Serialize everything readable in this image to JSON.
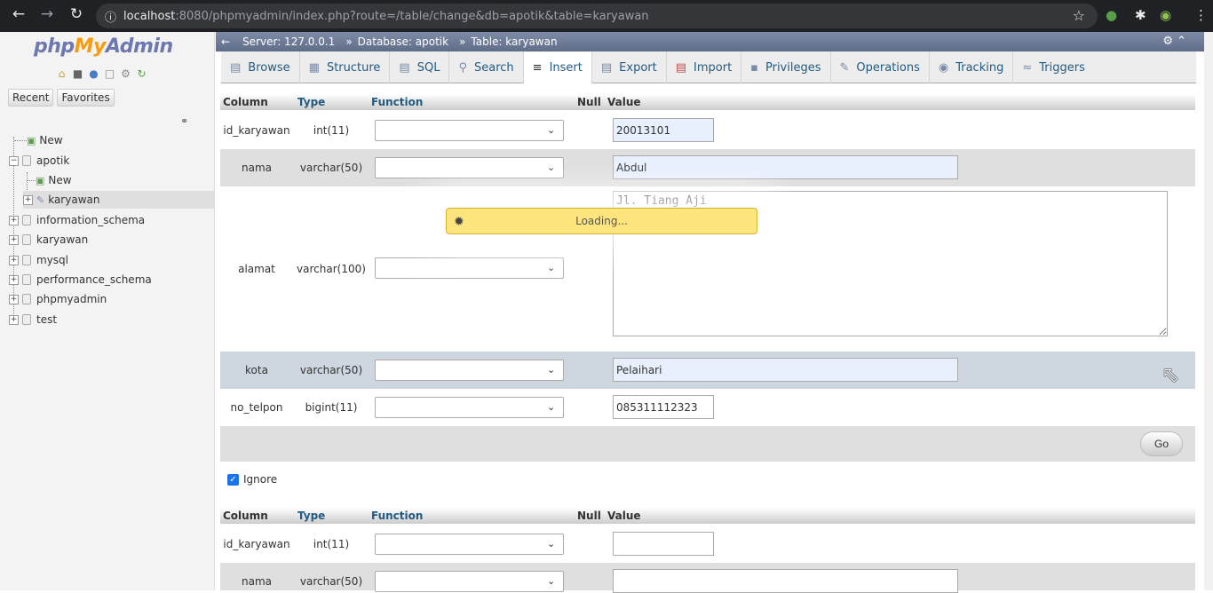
{
  "browser": {
    "url_host": "localhost",
    "url_rest": ":8080/phpmyadmin/index.php?route=/table/change&db=apotik&table=karyawan"
  },
  "nav": {
    "logo": {
      "php": "php",
      "my": "My",
      "admin": "Admin"
    },
    "tabs": {
      "recent": "Recent",
      "favorites": "Favorites"
    },
    "tree": {
      "new": "New",
      "apotik": "apotik",
      "apotik_new": "New",
      "karyawan_table": "karyawan",
      "information_schema": "information_schema",
      "karyawan_db": "karyawan",
      "mysql": "mysql",
      "performance_schema": "performance_schema",
      "phpmyadmin": "phpmyadmin",
      "test": "test"
    }
  },
  "breadcrumb": {
    "server": "Server: 127.0.0.1",
    "database": "Database: apotik",
    "table": "Table: karyawan"
  },
  "tabs": [
    {
      "label": "Browse",
      "icon": "browse-icon"
    },
    {
      "label": "Structure",
      "icon": "structure-icon"
    },
    {
      "label": "SQL",
      "icon": "sql-icon"
    },
    {
      "label": "Search",
      "icon": "search-icon"
    },
    {
      "label": "Insert",
      "icon": "insert-icon"
    },
    {
      "label": "Export",
      "icon": "export-icon"
    },
    {
      "label": "Import",
      "icon": "import-icon"
    },
    {
      "label": "Privileges",
      "icon": "privileges-icon"
    },
    {
      "label": "Operations",
      "icon": "operations-icon"
    },
    {
      "label": "Tracking",
      "icon": "tracking-icon"
    },
    {
      "label": "Triggers",
      "icon": "triggers-icon"
    }
  ],
  "table_header": {
    "column": "Column",
    "type": "Type",
    "function": "Function",
    "null": "Null",
    "value": "Value"
  },
  "form1": {
    "rows": [
      {
        "name": "id_karyawan",
        "type": "int(11)",
        "value": "20013101"
      },
      {
        "name": "nama",
        "type": "varchar(50)",
        "value": "Abdul"
      },
      {
        "name": "alamat",
        "type": "varchar(100)",
        "value": "Jl. Tiang Aji"
      },
      {
        "name": "kota",
        "type": "varchar(50)",
        "value": "Pelaihari"
      },
      {
        "name": "no_telpon",
        "type": "bigint(11)",
        "value": "085311112323"
      }
    ]
  },
  "go_label": "Go",
  "ignore_label": "Ignore",
  "form2": {
    "rows": [
      {
        "name": "id_karyawan",
        "type": "int(11)",
        "value": ""
      },
      {
        "name": "nama",
        "type": "varchar(50)",
        "value": ""
      }
    ]
  },
  "loading_text": "Loading..."
}
